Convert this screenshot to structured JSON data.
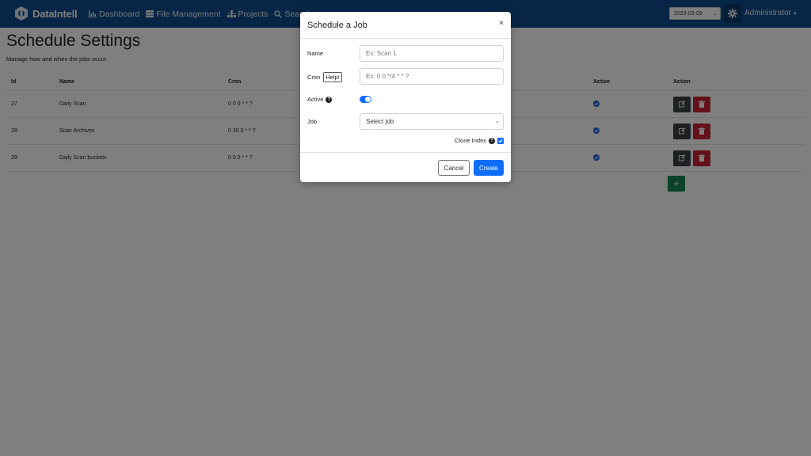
{
  "navbar": {
    "brand": "DataIntell",
    "links": [
      {
        "label": "Dashboard",
        "icon": "dashboard-icon"
      },
      {
        "label": "File Management",
        "icon": "file-management-icon"
      },
      {
        "label": "Projects",
        "icon": "projects-icon"
      },
      {
        "label": "Search",
        "icon": "search-icon"
      }
    ],
    "date_value": "2023-03-09",
    "user": "Administrator"
  },
  "page": {
    "title": "Schedule Settings",
    "subtitle": "Manage how and when the jobs occur."
  },
  "table": {
    "headers": {
      "id": "Id",
      "name": "Name",
      "cron": "Cron",
      "active": "Active",
      "action": "Action"
    },
    "rows": [
      {
        "id": "27",
        "name": "Daily Scan",
        "cron": "0 0 0 * * ?",
        "active": true
      },
      {
        "id": "28",
        "name": "Scan Archives",
        "cron": "0 30 0 * * ?",
        "active": true
      },
      {
        "id": "29",
        "name": "Daily Scan buckets",
        "cron": "0 0 2 * * ?",
        "active": true
      }
    ],
    "add_label": "+"
  },
  "modal": {
    "title": "Schedule a Job",
    "close": "×",
    "name_label": "Name",
    "name_placeholder": "Ex: Scan 1",
    "cron_label": "Cron",
    "help_label": "Help!",
    "cron_placeholder": "Ex: 0 0 */4 * * ?",
    "active_label": "Active",
    "active_on": true,
    "job_label": "Job",
    "job_value": "Select job",
    "clone_label": "Clone Index",
    "clone_checked": true,
    "cancel_label": "Cancel",
    "create_label": "Create"
  },
  "colors": {
    "navbar": "#0f4d8e",
    "primary": "#0d6efd",
    "danger": "#c82333",
    "success": "#198754",
    "dark": "#3d4246"
  }
}
